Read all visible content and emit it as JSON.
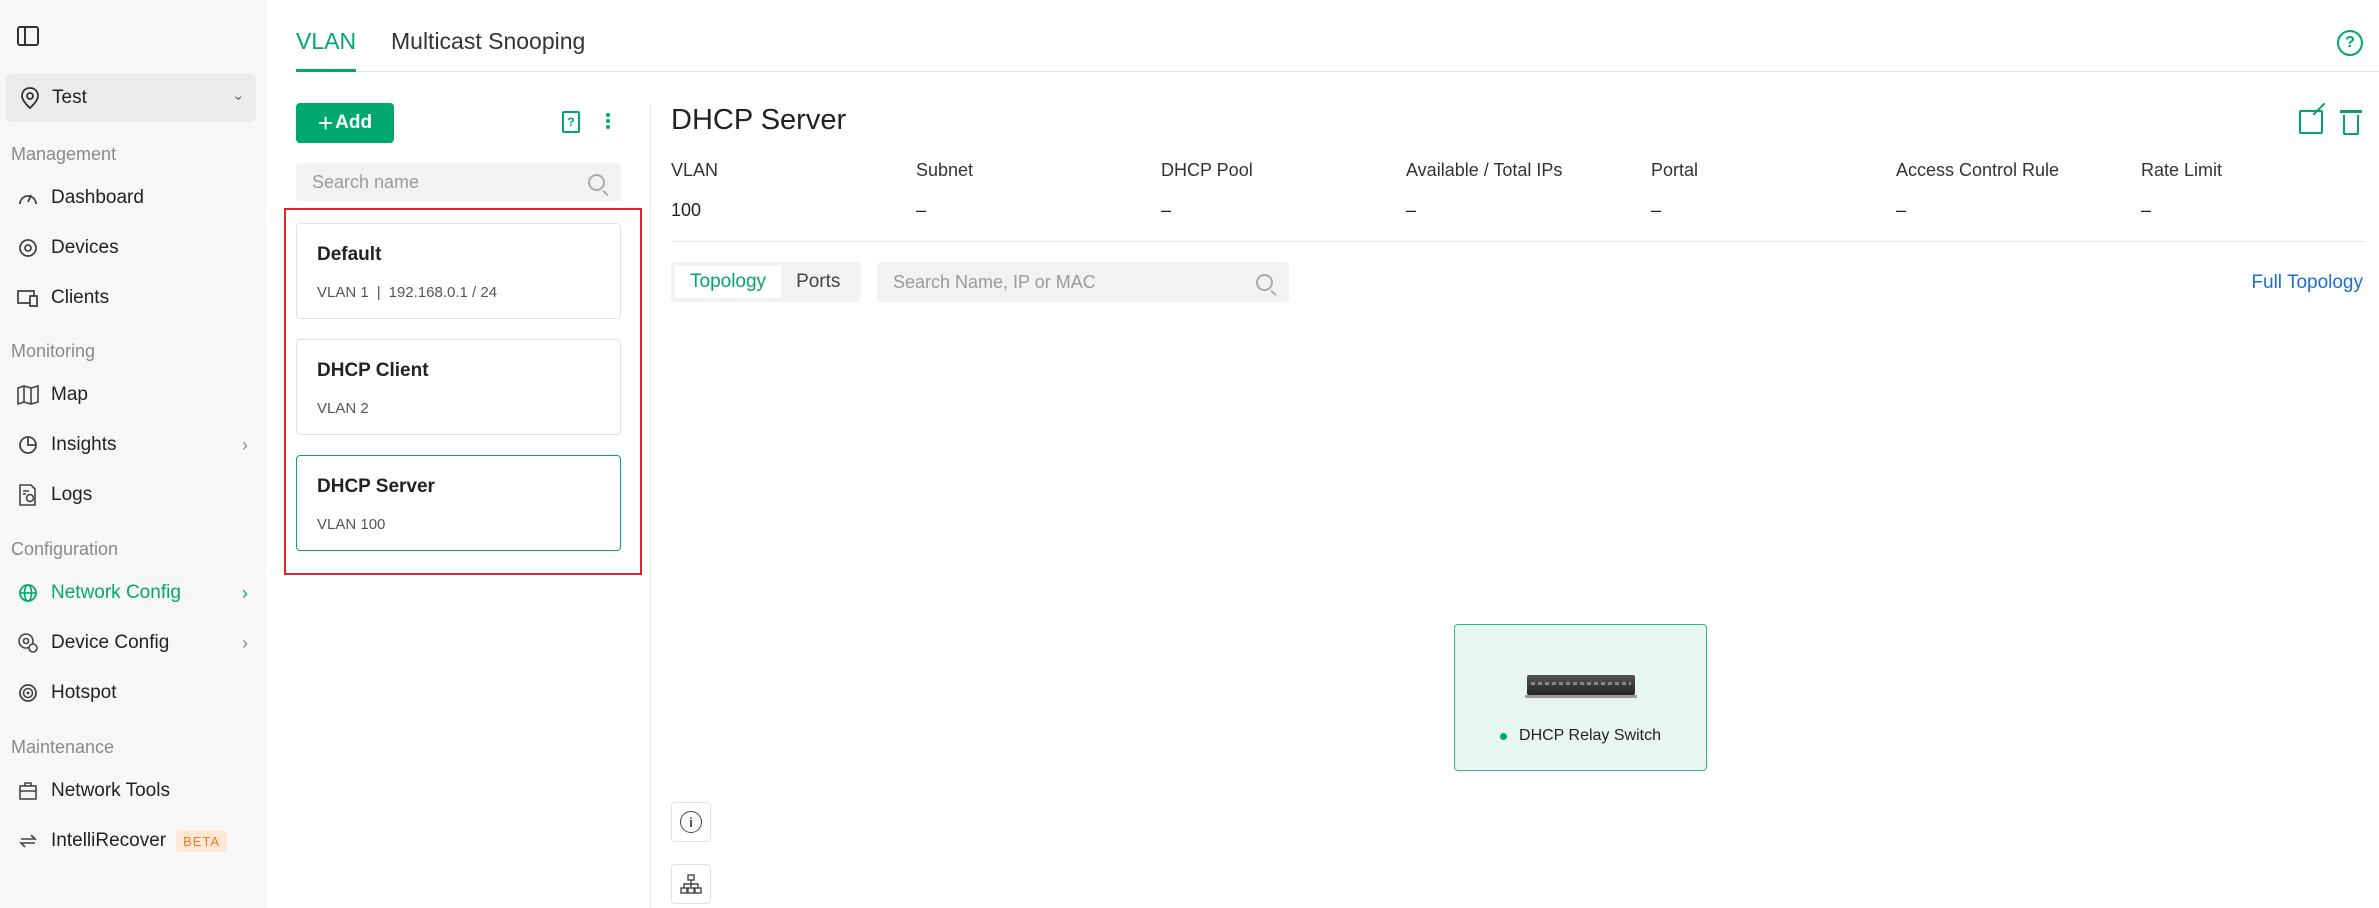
{
  "sidebar": {
    "site": {
      "name": "Test"
    },
    "sections": {
      "management": "Management",
      "monitoring": "Monitoring",
      "configuration": "Configuration",
      "maintenance": "Maintenance"
    },
    "items": {
      "dashboard": "Dashboard",
      "devices": "Devices",
      "clients": "Clients",
      "map": "Map",
      "insights": "Insights",
      "logs": "Logs",
      "network_config": "Network Config",
      "device_config": "Device Config",
      "hotspot": "Hotspot",
      "network_tools": "Network Tools",
      "intellirecover": "IntelliRecover",
      "beta_badge": "BETA"
    },
    "accent_color": "#00a870"
  },
  "tabs": {
    "vlan": "VLAN",
    "multicast": "Multicast Snooping"
  },
  "list": {
    "add_label": "Add",
    "search_placeholder": "Search name",
    "vlans": [
      {
        "name": "Default",
        "vlan": "VLAN 1",
        "subnet": "192.168.0.1 / 24"
      },
      {
        "name": "DHCP Client",
        "vlan": "VLAN 2"
      },
      {
        "name": "DHCP Server",
        "vlan": "VLAN 100"
      }
    ]
  },
  "detail": {
    "title": "DHCP Server",
    "columns": [
      {
        "label": "VLAN",
        "value": "100"
      },
      {
        "label": "Subnet",
        "value": "–"
      },
      {
        "label": "DHCP Pool",
        "value": "–"
      },
      {
        "label": "Available / Total IPs",
        "value": "–"
      },
      {
        "label": "Portal",
        "value": "–"
      },
      {
        "label": "Access Control Rule",
        "value": "–"
      },
      {
        "label": "Rate Limit",
        "value": "–"
      }
    ],
    "view_toggle": {
      "topology": "Topology",
      "ports": "Ports"
    },
    "device_search_placeholder": "Search Name, IP or MAC",
    "full_topology": "Full Topology",
    "device": {
      "name": "DHCP Relay Switch",
      "status_color": "#00a870"
    }
  }
}
